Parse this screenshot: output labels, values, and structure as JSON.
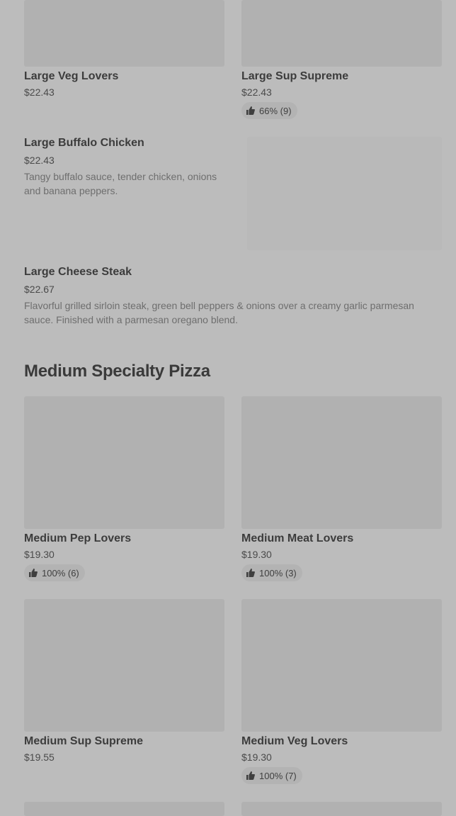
{
  "items_top": [
    {
      "title": "Large Veg Lovers",
      "price": "$22.43"
    },
    {
      "title": "Large Sup Supreme",
      "price": "$22.43",
      "rating": "66% (9)"
    }
  ],
  "rows": [
    {
      "title": "Large Buffalo Chicken",
      "price": "$22.43",
      "description": "Tangy buffalo sauce, tender chicken, onions and banana peppers."
    },
    {
      "title": "Large Cheese Steak",
      "price": "$22.67",
      "description": "Flavorful grilled sirloin steak, green bell peppers & onions over a creamy garlic parmesan sauce. Finished with a parmesan oregano blend."
    }
  ],
  "section": {
    "title": "Medium Specialty Pizza"
  },
  "medium_items": [
    {
      "title": "Medium Pep Lovers",
      "price": "$19.30",
      "rating": "100% (6)"
    },
    {
      "title": "Medium Meat Lovers",
      "price": "$19.30",
      "rating": "100% (3)"
    },
    {
      "title": "Medium Sup Supreme",
      "price": "$19.55"
    },
    {
      "title": "Medium Veg Lovers",
      "price": "$19.30",
      "rating": "100% (7)"
    }
  ],
  "icons": {
    "rating": "thumbs-up-icon"
  }
}
